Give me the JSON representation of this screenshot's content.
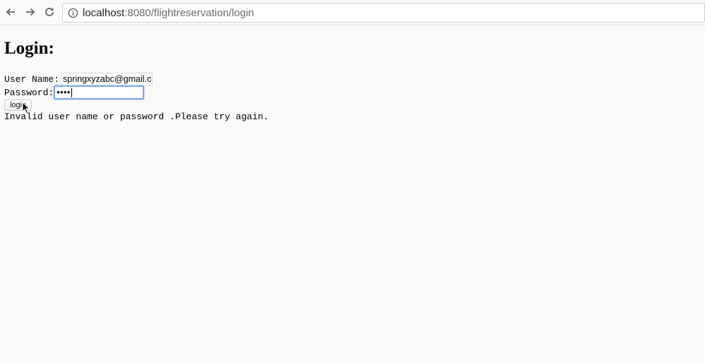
{
  "browser": {
    "url_host": "localhost",
    "url_path": ":8080/flightreservation/login",
    "icons": {
      "back": "back-arrow-icon",
      "forward": "forward-arrow-icon",
      "reload": "reload-icon",
      "site_info": "info-icon"
    }
  },
  "page": {
    "title": "Login:",
    "form": {
      "username_label": "User Name:",
      "username_value": "springxyzabc@gmail.com",
      "password_label": "Password:",
      "password_masked": "••••",
      "login_button_label": "login"
    },
    "error_message": "Invalid user name or password .Please try again."
  },
  "colors": {
    "focus_ring": "#7aa7e8",
    "page_background": "#fafaf8"
  }
}
